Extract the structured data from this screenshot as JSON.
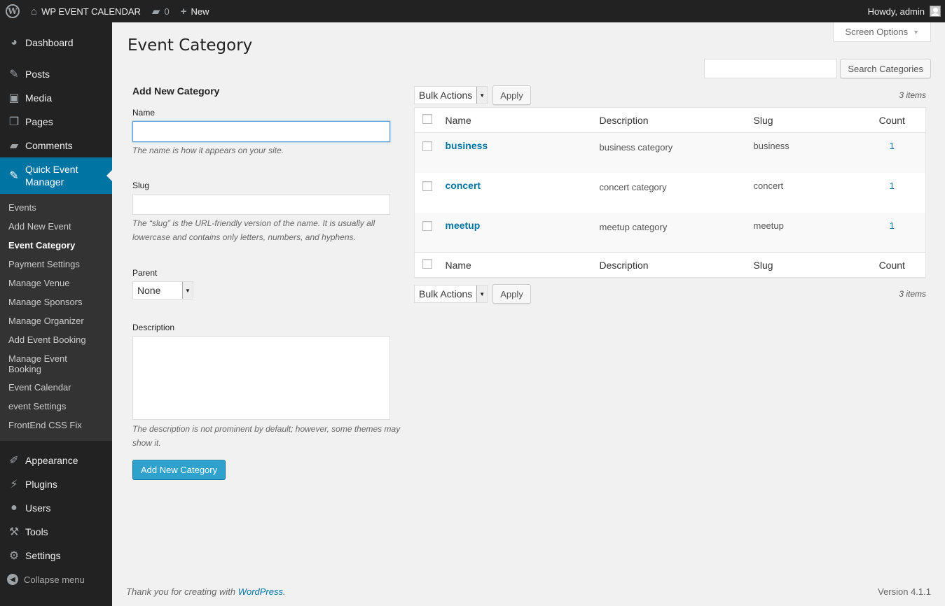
{
  "adminbar": {
    "site_name": "WP EVENT CALENDAR",
    "comments_count": "0",
    "new_label": "New",
    "howdy": "Howdy, admin"
  },
  "sidebar": {
    "top_items": [
      {
        "label": "Dashboard",
        "icon": "dashboard-icon"
      },
      {
        "label": "Posts",
        "icon": "pin-icon"
      },
      {
        "label": "Media",
        "icon": "media-icon"
      },
      {
        "label": "Pages",
        "icon": "pages-icon"
      },
      {
        "label": "Comments",
        "icon": "comment-icon"
      }
    ],
    "current": {
      "label": "Quick Event Manager",
      "icon": "pin-icon"
    },
    "submenu": [
      "Events",
      "Add New Event",
      "Event Category",
      "Payment Settings",
      "Manage Venue",
      "Manage Sponsors",
      "Manage Organizer",
      "Add Event Booking",
      "Manage Event Booking",
      "Event Calendar",
      "event Settings",
      "FrontEnd CSS Fix"
    ],
    "bottom_items": [
      {
        "label": "Appearance",
        "icon": "brush-icon"
      },
      {
        "label": "Plugins",
        "icon": "plugin-icon"
      },
      {
        "label": "Users",
        "icon": "user-icon"
      },
      {
        "label": "Tools",
        "icon": "wrench-icon"
      },
      {
        "label": "Settings",
        "icon": "settings-icon"
      }
    ],
    "collapse_label": "Collapse menu"
  },
  "screen_options": "Screen Options",
  "page_title": "Event Category",
  "search": {
    "value": "",
    "button": "Search Categories"
  },
  "form": {
    "heading": "Add New Category",
    "name_label": "Name",
    "name_value": "",
    "name_help": "The name is how it appears on your site.",
    "slug_label": "Slug",
    "slug_value": "",
    "slug_help": "The “slug” is the URL-friendly version of the name. It is usually all lowercase and contains only letters, numbers, and hyphens.",
    "parent_label": "Parent",
    "parent_value": "None",
    "description_label": "Description",
    "description_value": "",
    "description_help": "The description is not prominent by default; however, some themes may show it.",
    "submit": "Add New Category"
  },
  "table": {
    "bulk_actions": "Bulk Actions",
    "apply": "Apply",
    "items_count": "3 items",
    "columns": [
      "Name",
      "Description",
      "Slug",
      "Count"
    ],
    "rows": [
      {
        "name": "business",
        "description": "business category",
        "slug": "business",
        "count": "1"
      },
      {
        "name": "concert",
        "description": "concert category",
        "slug": "concert",
        "count": "1"
      },
      {
        "name": "meetup",
        "description": "meetup category",
        "slug": "meetup",
        "count": "1"
      }
    ]
  },
  "footer": {
    "thanks_prefix": "Thank you for creating with ",
    "thanks_link": "WordPress",
    "thanks_suffix": ".",
    "version": "Version 4.1.1"
  },
  "colors": {
    "accent": "#0074a2",
    "primary_button": "#2ea2cc",
    "sidebar": "#222222"
  }
}
